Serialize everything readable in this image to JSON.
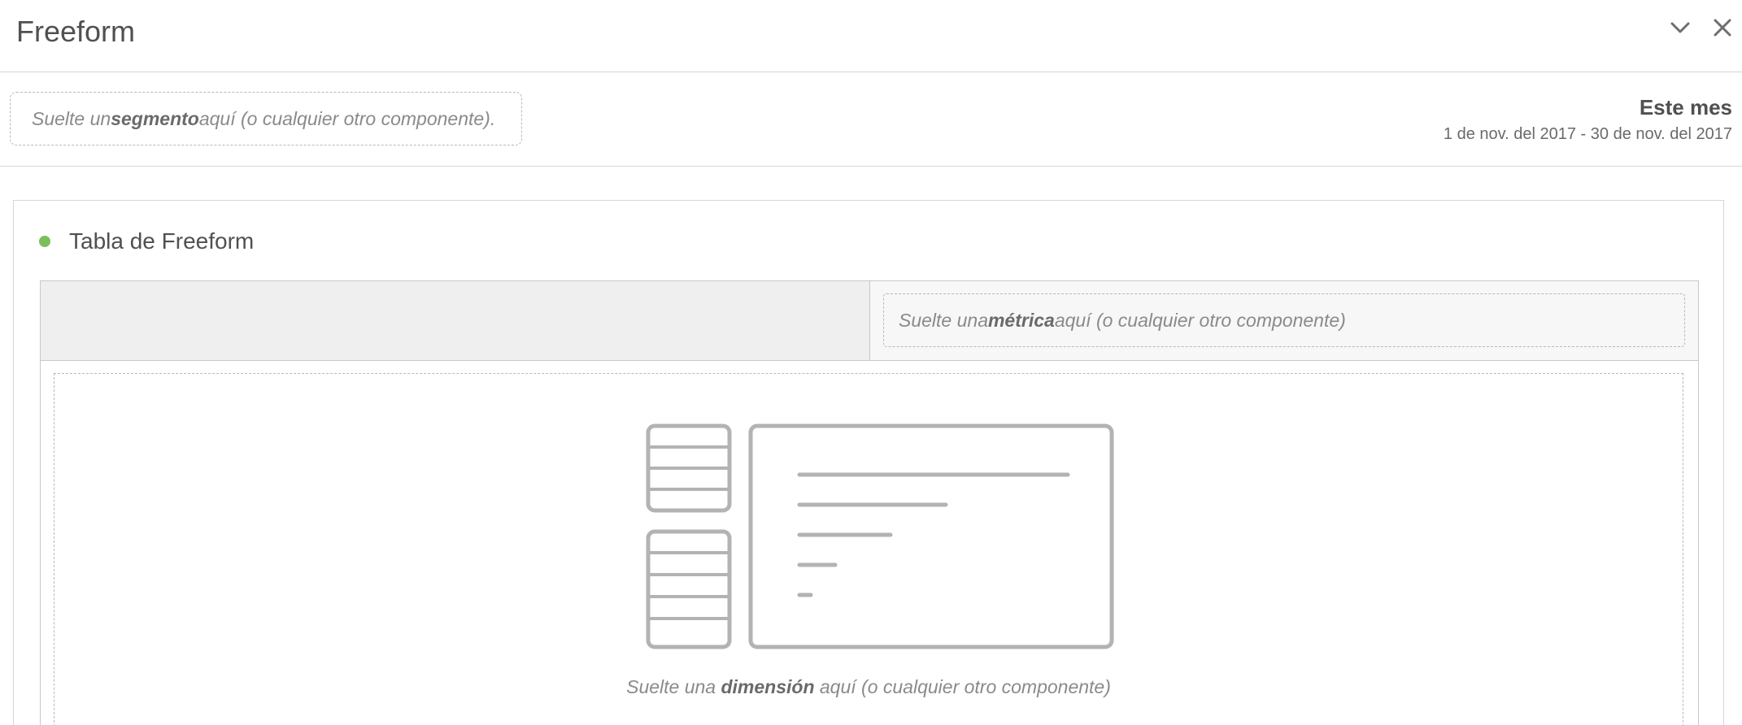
{
  "panel": {
    "title": "Freeform"
  },
  "icons": {
    "collapse": "chevron-down-icon",
    "close": "close-icon",
    "illustration": "freeform-table-illustration"
  },
  "segment_drop": {
    "prefix": "Suelte un ",
    "bold": "segmento",
    "suffix": " aquí (o cualquier otro componente)."
  },
  "date_range": {
    "label": "Este mes",
    "value": "1 de nov. del 2017 - 30 de nov. del 2017"
  },
  "card": {
    "title": "Tabla de Freeform",
    "status_color": "#7cbf5a"
  },
  "metric_drop": {
    "prefix": "Suelte una ",
    "bold": "métrica",
    "suffix": " aquí (o cualquier otro componente)"
  },
  "dimension_drop": {
    "prefix": "Suelte una ",
    "bold": "dimensión",
    "suffix": " aquí (o cualquier otro componente)"
  }
}
